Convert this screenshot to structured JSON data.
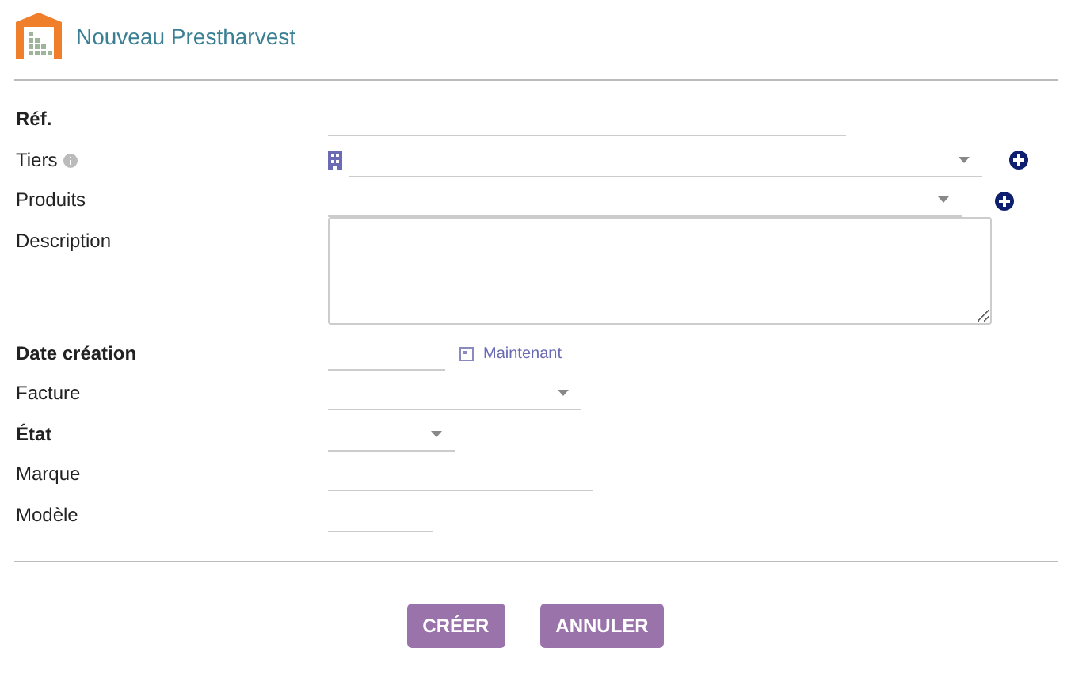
{
  "header": {
    "title": "Nouveau Prestharvest"
  },
  "fields": [
    {
      "label": "Réf.",
      "kind": "text",
      "required": true,
      "info": false,
      "add": false,
      "building": false
    },
    {
      "label": "Tiers",
      "kind": "select",
      "required": false,
      "info": true,
      "add": true,
      "building": true
    },
    {
      "label": "Produits",
      "kind": "select",
      "required": false,
      "info": false,
      "add": true,
      "building": false
    },
    {
      "label": "Description",
      "kind": "textarea",
      "required": false,
      "info": false,
      "add": false,
      "building": false
    },
    {
      "label": "Date création",
      "kind": "date",
      "required": true,
      "info": false,
      "add": false,
      "building": false,
      "now_link": "Maintenant"
    },
    {
      "label": "Facture",
      "kind": "select",
      "required": false,
      "info": false,
      "add": false,
      "building": false
    },
    {
      "label": "État",
      "kind": "select",
      "required": true,
      "info": false,
      "add": false,
      "building": false
    },
    {
      "label": "Marque",
      "kind": "text",
      "required": false,
      "info": false,
      "add": false,
      "building": false
    },
    {
      "label": "Modèle",
      "kind": "text",
      "required": false,
      "info": false,
      "add": false,
      "building": false
    }
  ],
  "buttons": [
    {
      "label": "CRÉER"
    },
    {
      "label": "ANNULER"
    }
  ]
}
